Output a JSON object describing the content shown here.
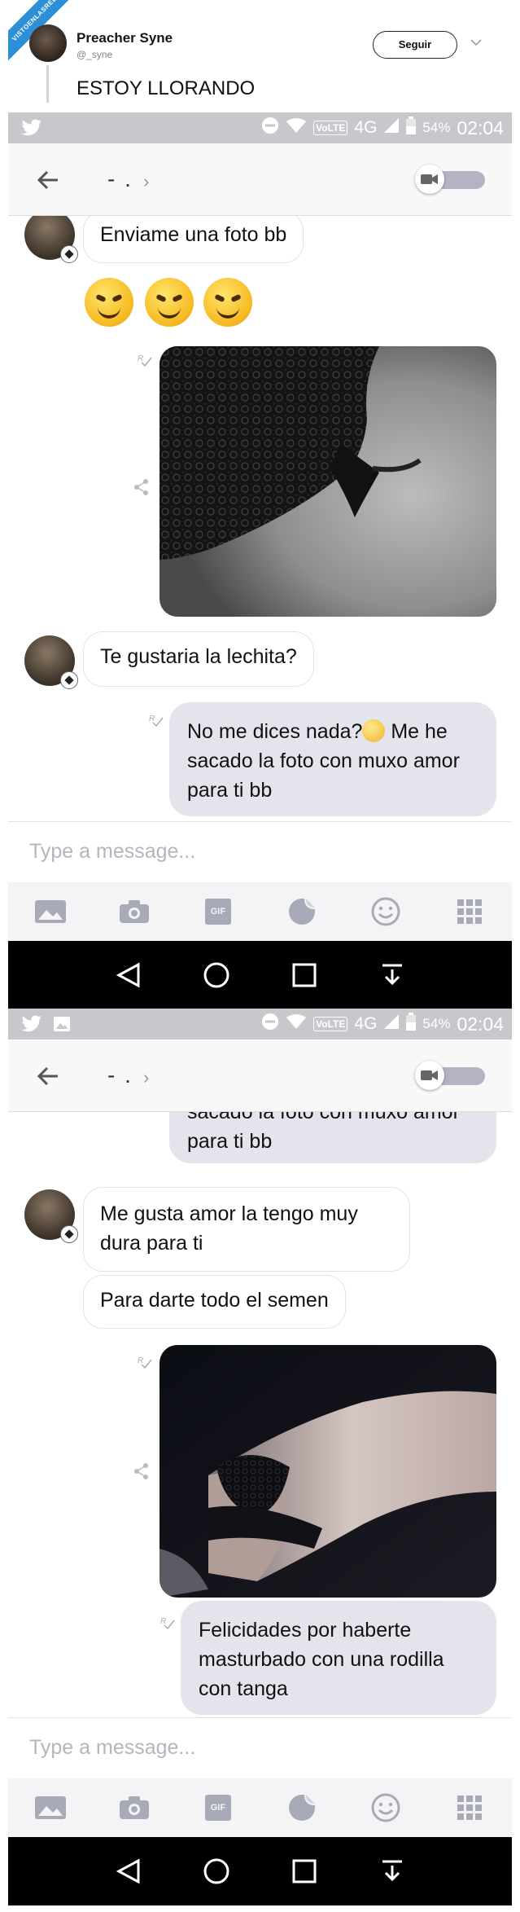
{
  "watermark": "VISTOENLASREDES",
  "tweet": {
    "author_name": "Preacher Syne",
    "handle": "@_syne",
    "follow_label": "Seguir",
    "text": "ESTOY LLORANDO"
  },
  "status_bar": {
    "network_badge": "VoLTE",
    "network": "4G",
    "battery": "54%",
    "time": "02:04"
  },
  "chat_header": {
    "title": "- .",
    "chevron": "›"
  },
  "screen1": {
    "messages": [
      {
        "dir": "in",
        "text": "Enviame una foto bb"
      },
      {
        "dir": "in",
        "type": "emoji",
        "icons": [
          "smiling-devil-emoji",
          "smiling-devil-emoji",
          "smiling-devil-emoji"
        ]
      },
      {
        "dir": "out",
        "type": "photo",
        "icon": "photo-lace-black"
      },
      {
        "dir": "in",
        "text": "Te gustaria la lechita?"
      },
      {
        "dir": "out",
        "text_before_emoji": "No me dices nada?",
        "text_after_emoji": " Me he sacado la foto con muxo amor para ti bb"
      }
    ]
  },
  "screen2": {
    "messages": [
      {
        "dir": "out",
        "text": "sacado la foto con muxo amor para ti bb"
      },
      {
        "dir": "in",
        "text": "Me gusta amor la tengo muy dura para ti"
      },
      {
        "dir": "in",
        "text": "Para darte todo el semen"
      },
      {
        "dir": "out",
        "type": "photo",
        "icon": "photo-dark-room"
      },
      {
        "dir": "out",
        "text": "Felicidades por haberte masturbado con una rodilla con tanga"
      }
    ]
  },
  "composer": {
    "placeholder": "Type a message...",
    "tools": [
      "image-icon",
      "camera-icon",
      "gif-icon",
      "sticker-icon",
      "emoji-icon",
      "apps-grid-icon"
    ],
    "gif_label": "GIF"
  },
  "colors": {
    "status_bar": "#c8c8cc",
    "bubble_out": "#e4e4ec",
    "nav_bar": "#000000",
    "watermark": "#2d8fd6"
  }
}
